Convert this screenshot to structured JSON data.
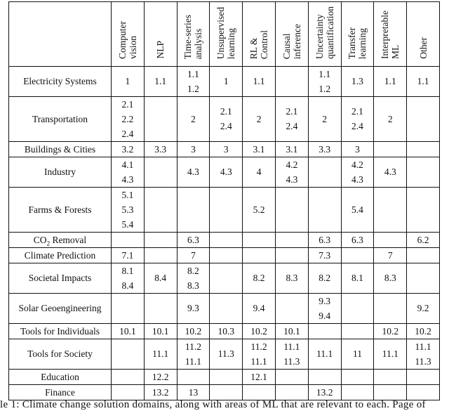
{
  "table": {
    "corner": "",
    "columns": [
      "Computer\nvision",
      "NLP",
      "Time-series\nanalysis",
      "Unsupervised\nlearning",
      "RL &\nControl",
      "Causal\ninference",
      "Uncertainty\nquantification",
      "Transfer\nlearning",
      "Interpretable\nML",
      "Other"
    ],
    "rows": [
      {
        "domain": "Electricity Systems",
        "cells": [
          [
            "1"
          ],
          [
            "1.1"
          ],
          [
            "1.1",
            "1.2"
          ],
          [
            "1"
          ],
          [
            "1.1"
          ],
          [],
          [
            "1.1",
            "1.2"
          ],
          [
            "1.3"
          ],
          [
            "1.1"
          ],
          [
            "1.1"
          ]
        ]
      },
      {
        "domain": "Transportation",
        "cells": [
          [
            "2.1",
            "2.2",
            "2.4"
          ],
          [],
          [
            "2"
          ],
          [
            "2.1",
            "2.4"
          ],
          [
            "2"
          ],
          [
            "2.1",
            "2.4"
          ],
          [
            "2"
          ],
          [
            "2.1",
            "2.4"
          ],
          [
            "2"
          ],
          []
        ]
      },
      {
        "domain": "Buildings & Cities",
        "cells": [
          [
            "3.2"
          ],
          [
            "3.3"
          ],
          [
            "3"
          ],
          [
            "3"
          ],
          [
            "3.1"
          ],
          [
            "3.1"
          ],
          [
            "3.3"
          ],
          [
            "3"
          ],
          [],
          []
        ]
      },
      {
        "domain": "Industry",
        "cells": [
          [
            "4.1",
            "4.3"
          ],
          [],
          [
            "4.3"
          ],
          [
            "4.3"
          ],
          [
            "4"
          ],
          [
            "4.2",
            "4.3"
          ],
          [],
          [
            "4.2",
            "4.3"
          ],
          [
            "4.3"
          ],
          []
        ]
      },
      {
        "domain": "Farms & Forests",
        "cells": [
          [
            "5.1",
            "5.3",
            "5.4"
          ],
          [],
          [],
          [],
          [
            "5.2"
          ],
          [],
          [],
          [
            "5.4"
          ],
          [],
          []
        ]
      },
      {
        "domain": "CO2 Removal",
        "domain_main": "CO",
        "domain_sub": "2",
        "domain_rest": " Removal",
        "cells": [
          [],
          [],
          [
            "6.3"
          ],
          [],
          [],
          [],
          [
            "6.3"
          ],
          [
            "6.3"
          ],
          [],
          [
            "6.2"
          ]
        ]
      },
      {
        "domain": "Climate Prediction",
        "cells": [
          [
            "7.1"
          ],
          [],
          [
            "7"
          ],
          [],
          [],
          [],
          [
            "7.3"
          ],
          [],
          [
            "7"
          ],
          []
        ]
      },
      {
        "domain": "Societal Impacts",
        "cells": [
          [
            "8.1",
            "8.4"
          ],
          [
            "8.4"
          ],
          [
            "8.2",
            "8.3"
          ],
          [],
          [
            "8.2"
          ],
          [
            "8.3"
          ],
          [
            "8.2"
          ],
          [
            "8.1"
          ],
          [
            "8.3"
          ],
          []
        ]
      },
      {
        "domain": "Solar Geoengineering",
        "cells": [
          [],
          [],
          [
            "9.3"
          ],
          [],
          [
            "9.4"
          ],
          [],
          [
            "9.3",
            "9.4"
          ],
          [],
          [],
          [
            "9.2"
          ]
        ]
      },
      {
        "domain": "Tools for Individuals",
        "cells": [
          [
            "10.1"
          ],
          [
            "10.1"
          ],
          [
            "10.2"
          ],
          [
            "10.3"
          ],
          [
            "10.2"
          ],
          [
            "10.1"
          ],
          [],
          [],
          [
            "10.2"
          ],
          [
            "10.2"
          ]
        ]
      },
      {
        "domain": "Tools for Society",
        "cells": [
          [],
          [
            "11.1"
          ],
          [
            "11.2",
            "11.1"
          ],
          [
            "11.3"
          ],
          [
            "11.2",
            "11.1"
          ],
          [
            "11.1",
            "11.3"
          ],
          [
            "11.1"
          ],
          [
            "11"
          ],
          [
            "11.1"
          ],
          [
            "11.1",
            "11.3"
          ]
        ]
      },
      {
        "domain": "Education",
        "cells": [
          [],
          [
            "12.2"
          ],
          [],
          [],
          [
            "12.1"
          ],
          [],
          [],
          [],
          [],
          []
        ]
      },
      {
        "domain": "Finance",
        "cells": [
          [],
          [
            "13.2"
          ],
          [
            "13"
          ],
          [],
          [],
          [],
          [
            "13.2"
          ],
          [],
          [],
          []
        ]
      }
    ]
  },
  "caption": "le 1: Climate change solution domains, along with areas of ML that are relevant to each. Page of"
}
